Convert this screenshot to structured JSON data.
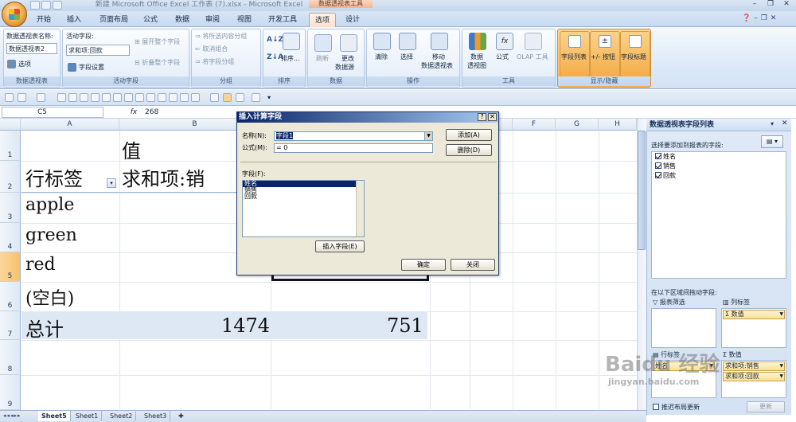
{
  "window": {
    "title": "新建 Microsoft Office Excel 工作表 (7).xlsx - Microsoft Excel",
    "context_tools": "数据透视表工具"
  },
  "tabs": [
    "开始",
    "插入",
    "页面布局",
    "公式",
    "数据",
    "审阅",
    "视图",
    "开发工具",
    "选项",
    "设计"
  ],
  "active_tab": "选项",
  "ribbon": {
    "pivot_table": {
      "name_label": "数据透视表名称:",
      "name_value": "数据透视表2",
      "options_btn": "选项",
      "group_label": "数据透视表"
    },
    "active_field": {
      "label": "活动字段:",
      "value": "求和项:回款",
      "settings_btn": "字段设置",
      "expand_btn": "展开整个字段",
      "collapse_btn": "折叠整个字段",
      "group_label": "活动字段"
    },
    "group": {
      "sel_btn": "将所选内容分组",
      "ungroup_btn": "取消组合",
      "field_btn": "将字段分组",
      "group_label": "分组"
    },
    "sort": {
      "btn": "排序...",
      "group_label": "排序"
    },
    "data": {
      "refresh_btn": "刷新",
      "source_btn1": "更改",
      "source_btn2": "数据源",
      "group_label": "数据"
    },
    "actions": {
      "clear_btn": "清除",
      "select_btn": "选择",
      "move_btn1": "移动",
      "move_btn2": "数据透视表",
      "group_label": "操作"
    },
    "tools": {
      "chart_btn1": "数据",
      "chart_btn2": "透视图",
      "formula_btn": "公式",
      "olap_btn": "OLAP 工具",
      "group_label": "工具"
    },
    "show": {
      "field_list_btn": "字段列表",
      "buttons_btn": "+/- 按钮",
      "headers_btn": "字段标题",
      "group_label": "显示/隐藏"
    }
  },
  "formula_bar": {
    "name_box": "C5",
    "fx": "fx",
    "content": "268"
  },
  "grid": {
    "columns": [
      "A",
      "B",
      "C",
      "D",
      "E",
      "F",
      "G",
      "H"
    ],
    "rows": [
      "1",
      "2",
      "3",
      "4",
      "5",
      "6",
      "7",
      "8",
      "9"
    ],
    "selected_row": "5",
    "cells": {
      "b1": "值",
      "a2": "行标签",
      "b2": "求和项:销",
      "a3": "apple",
      "a4": "green",
      "a5": "red",
      "a6": "(空白)",
      "a7": "总计",
      "b7": "1474",
      "c7": "751"
    }
  },
  "dialog": {
    "title": "插入计算字段",
    "help": "?",
    "close": "✕",
    "name_label": "名称(N):",
    "name_value": "字段1",
    "formula_label": "公式(M):",
    "formula_value": "= 0",
    "add_btn": "添加(A)",
    "delete_btn": "删除(D)",
    "fields_label": "字段(F):",
    "fields": [
      "姓名",
      "销售",
      "回款"
    ],
    "insert_field_btn": "插入字段(E)",
    "ok_btn": "确定",
    "close_btn": "关闭"
  },
  "field_list": {
    "title": "数据透视表字段列表",
    "choose_label": "选择要添加到报表的字段:",
    "fields": [
      "姓名",
      "销售",
      "回款"
    ],
    "drag_label": "在以下区域间拖动字段:",
    "report_filter": "报表筛选",
    "column_labels": "列标签",
    "row_labels": "行标签",
    "values": "数值",
    "column_chip": "数值",
    "row_chip": "姓名",
    "value_chips": [
      "求和项:销售",
      "求和项:回款"
    ],
    "defer_label": "推迟布局更新",
    "update_btn": "更新"
  },
  "sheets": [
    "Sheet5",
    "Sheet1",
    "Sheet2",
    "Sheet3"
  ],
  "active_sheet": "Sheet5",
  "watermark": {
    "line1": "Baidu 经验",
    "line2": "jingyan.baidu.com"
  }
}
